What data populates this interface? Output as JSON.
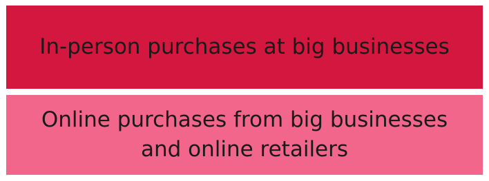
{
  "boxes": {
    "top": {
      "label": "In-person purchases at big businesses",
      "color": "#d4173f"
    },
    "bottom": {
      "label": "Online purchases from big businesses and online retailers",
      "color": "#f2668b"
    }
  }
}
